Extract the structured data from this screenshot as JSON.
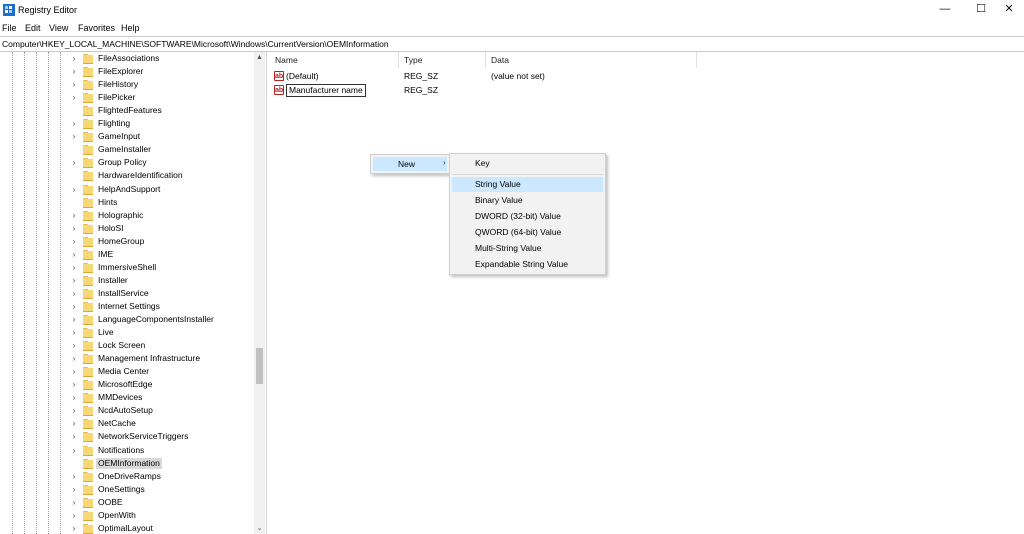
{
  "window": {
    "title": "Registry Editor",
    "minimize_glyph": "—",
    "maximize_glyph": "☐",
    "close_glyph": "✕",
    "icon": "registry-editor-icon"
  },
  "menu": [
    "File",
    "Edit",
    "View",
    "Favorites",
    "Help"
  ],
  "address": "Computer\\HKEY_LOCAL_MACHINE\\SOFTWARE\\Microsoft\\Windows\\CurrentVersion\\OEMInformation",
  "tree": {
    "chevron_glyph": "›",
    "items": [
      {
        "label": "FileAssociations",
        "expandable": true
      },
      {
        "label": "FileExplorer",
        "expandable": true
      },
      {
        "label": "FileHistory",
        "expandable": true
      },
      {
        "label": "FilePicker",
        "expandable": true
      },
      {
        "label": "FlightedFeatures",
        "expandable": false
      },
      {
        "label": "Flighting",
        "expandable": true
      },
      {
        "label": "GameInput",
        "expandable": true
      },
      {
        "label": "GameInstaller",
        "expandable": false
      },
      {
        "label": "Group Policy",
        "expandable": true
      },
      {
        "label": "HardwareIdentification",
        "expandable": false
      },
      {
        "label": "HelpAndSupport",
        "expandable": true
      },
      {
        "label": "Hints",
        "expandable": false
      },
      {
        "label": "Holographic",
        "expandable": true
      },
      {
        "label": "HoloSI",
        "expandable": true
      },
      {
        "label": "HomeGroup",
        "expandable": true
      },
      {
        "label": "IME",
        "expandable": true
      },
      {
        "label": "ImmersiveShell",
        "expandable": true
      },
      {
        "label": "Installer",
        "expandable": true
      },
      {
        "label": "InstallService",
        "expandable": true
      },
      {
        "label": "Internet Settings",
        "expandable": true
      },
      {
        "label": "LanguageComponentsInstaller",
        "expandable": true
      },
      {
        "label": "Live",
        "expandable": true
      },
      {
        "label": "Lock Screen",
        "expandable": true
      },
      {
        "label": "Management Infrastructure",
        "expandable": true
      },
      {
        "label": "Media Center",
        "expandable": true
      },
      {
        "label": "MicrosoftEdge",
        "expandable": true
      },
      {
        "label": "MMDevices",
        "expandable": true
      },
      {
        "label": "NcdAutoSetup",
        "expandable": true
      },
      {
        "label": "NetCache",
        "expandable": true
      },
      {
        "label": "NetworkServiceTriggers",
        "expandable": true
      },
      {
        "label": "Notifications",
        "expandable": true
      },
      {
        "label": "OEMInformation",
        "expandable": false,
        "selected": true
      },
      {
        "label": "OneDriveRamps",
        "expandable": true
      },
      {
        "label": "OneSettings",
        "expandable": true
      },
      {
        "label": "OOBE",
        "expandable": true
      },
      {
        "label": "OpenWith",
        "expandable": true
      },
      {
        "label": "OptimalLayout",
        "expandable": true
      }
    ]
  },
  "scrollbar": {
    "up_glyph": "▲",
    "down_glyph": "⌄"
  },
  "list": {
    "columns": [
      "Name",
      "Type",
      "Data"
    ],
    "icon_glyph": "ab",
    "rows": [
      {
        "name": "(Default)",
        "type": "REG_SZ",
        "data": "(value not set)",
        "editing": false
      },
      {
        "name": "Manufacturer name",
        "type": "REG_SZ",
        "data": "",
        "editing": true
      }
    ]
  },
  "context_menu": {
    "label": "New",
    "arrow_glyph": "›",
    "submenu": [
      {
        "label": "Key"
      },
      {
        "label": "String Value",
        "highlight": true
      },
      {
        "label": "Binary Value"
      },
      {
        "label": "DWORD (32-bit) Value"
      },
      {
        "label": "QWORD (64-bit) Value"
      },
      {
        "label": "Multi-String Value"
      },
      {
        "label": "Expandable String Value"
      }
    ]
  },
  "colors": {
    "selection": "#cce8ff",
    "tree_selected": "#d9d9d9",
    "folder": "#f8d775"
  }
}
